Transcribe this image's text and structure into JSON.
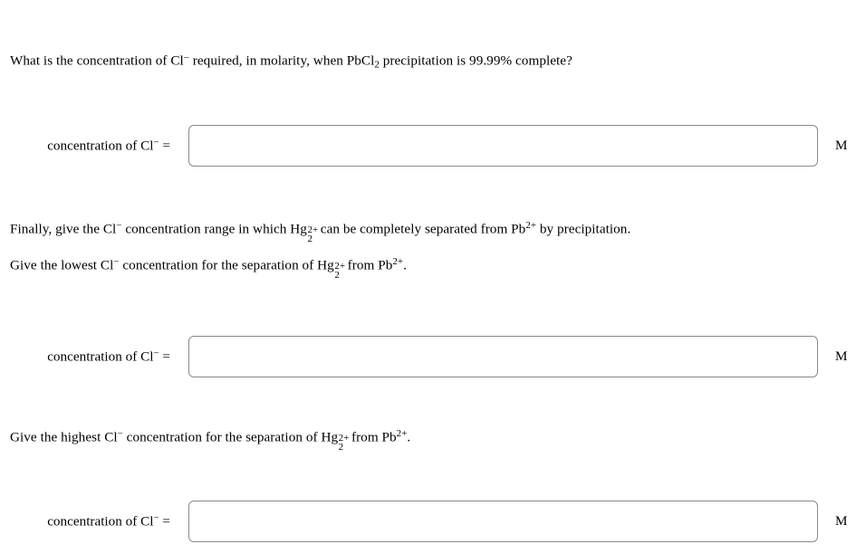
{
  "page": {
    "background_color": "#ffffff",
    "text_color": "#000000",
    "input_border_color": "#8a8a8a"
  },
  "questions": [
    {
      "id": "q1",
      "lines": [
        {
          "parts": [
            {
              "type": "text",
              "text": "What is the concentration of "
            },
            {
              "type": "ion",
              "base": "Cl",
              "sup": "−"
            },
            {
              "type": "text",
              "text": " required, in molarity, when "
            },
            {
              "type": "formula",
              "base": "PbCl",
              "sub": "2"
            },
            {
              "type": "text",
              "text": " precipitation is 99.99% complete?"
            }
          ],
          "plain": "What is the concentration of Cl⁻ required, in molarity, when PbCl₂ precipitation is 99.99% complete?"
        }
      ],
      "answer": {
        "label_prefix": "concentration of ",
        "label_ion_base": "Cl",
        "label_ion_sup": "−",
        "label_suffix": " =",
        "label_plain": "concentration of Cl⁻ =",
        "value": "",
        "placeholder": "",
        "unit": "M"
      }
    },
    {
      "id": "q2",
      "lines": [
        {
          "parts": [
            {
              "type": "text",
              "text": "Finally, give the "
            },
            {
              "type": "ion",
              "base": "Cl",
              "sup": "−"
            },
            {
              "type": "text",
              "text": " concentration range in which "
            },
            {
              "type": "subsup",
              "base": "Hg",
              "sub": "2",
              "sup": "2+"
            },
            {
              "type": "text",
              "text": " can be completely separated from "
            },
            {
              "type": "ion",
              "base": "Pb",
              "sup": "2+"
            },
            {
              "type": "text",
              "text": " by precipitation."
            }
          ],
          "plain": "Finally, give the Cl⁻ concentration range in which Hg₂²⁺ can be completely separated from Pb²⁺ by precipitation."
        },
        {
          "parts": [
            {
              "type": "text",
              "text": "Give the lowest "
            },
            {
              "type": "ion",
              "base": "Cl",
              "sup": "−"
            },
            {
              "type": "text",
              "text": " concentration for the separation of "
            },
            {
              "type": "subsup",
              "base": "Hg",
              "sub": "2",
              "sup": "2+"
            },
            {
              "type": "text",
              "text": " from "
            },
            {
              "type": "ion",
              "base": "Pb",
              "sup": "2+"
            },
            {
              "type": "text",
              "text": "."
            }
          ],
          "plain": "Give the lowest Cl⁻ concentration for the separation of Hg₂²⁺ from Pb²⁺."
        }
      ],
      "answer": {
        "label_prefix": "concentration of ",
        "label_ion_base": "Cl",
        "label_ion_sup": "−",
        "label_suffix": " =",
        "label_plain": "concentration of Cl⁻ =",
        "value": "",
        "placeholder": "",
        "unit": "M"
      }
    },
    {
      "id": "q3",
      "lines": [
        {
          "parts": [
            {
              "type": "text",
              "text": "Give the highest "
            },
            {
              "type": "ion",
              "base": "Cl",
              "sup": "−"
            },
            {
              "type": "text",
              "text": " concentration for the separation of "
            },
            {
              "type": "subsup",
              "base": "Hg",
              "sub": "2",
              "sup": "2+"
            },
            {
              "type": "text",
              "text": " from "
            },
            {
              "type": "ion",
              "base": "Pb",
              "sup": "2+"
            },
            {
              "type": "text",
              "text": "."
            }
          ],
          "plain": "Give the highest Cl⁻ concentration for the separation of Hg₂²⁺ from Pb²⁺."
        }
      ],
      "answer": {
        "label_prefix": "concentration of ",
        "label_ion_base": "Cl",
        "label_ion_sup": "−",
        "label_suffix": " =",
        "label_plain": "concentration of Cl⁻ =",
        "value": "",
        "placeholder": "",
        "unit": "M"
      }
    }
  ]
}
